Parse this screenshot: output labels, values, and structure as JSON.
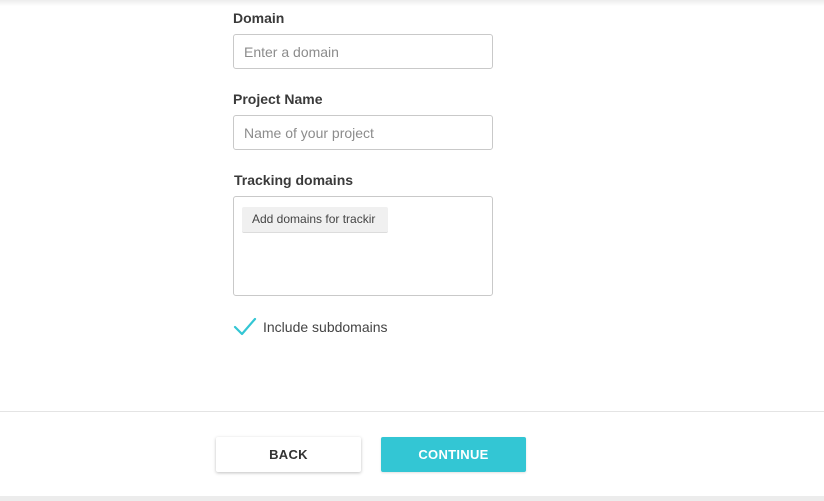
{
  "form": {
    "domain": {
      "label": "Domain",
      "value": "",
      "placeholder": "Enter a domain"
    },
    "project_name": {
      "label": "Project Name",
      "value": "",
      "placeholder": "Name of your project"
    },
    "tracking_domains": {
      "label": "Tracking domains",
      "chip_text": "Add domains for trackir"
    },
    "include_subdomains": {
      "label": "Include subdomains",
      "checked": true,
      "check_icon": "checkmark-icon",
      "check_color": "#33c6d4"
    }
  },
  "actions": {
    "back_label": "BACK",
    "continue_label": "CONTINUE"
  },
  "colors": {
    "accent": "#33c6d4"
  }
}
